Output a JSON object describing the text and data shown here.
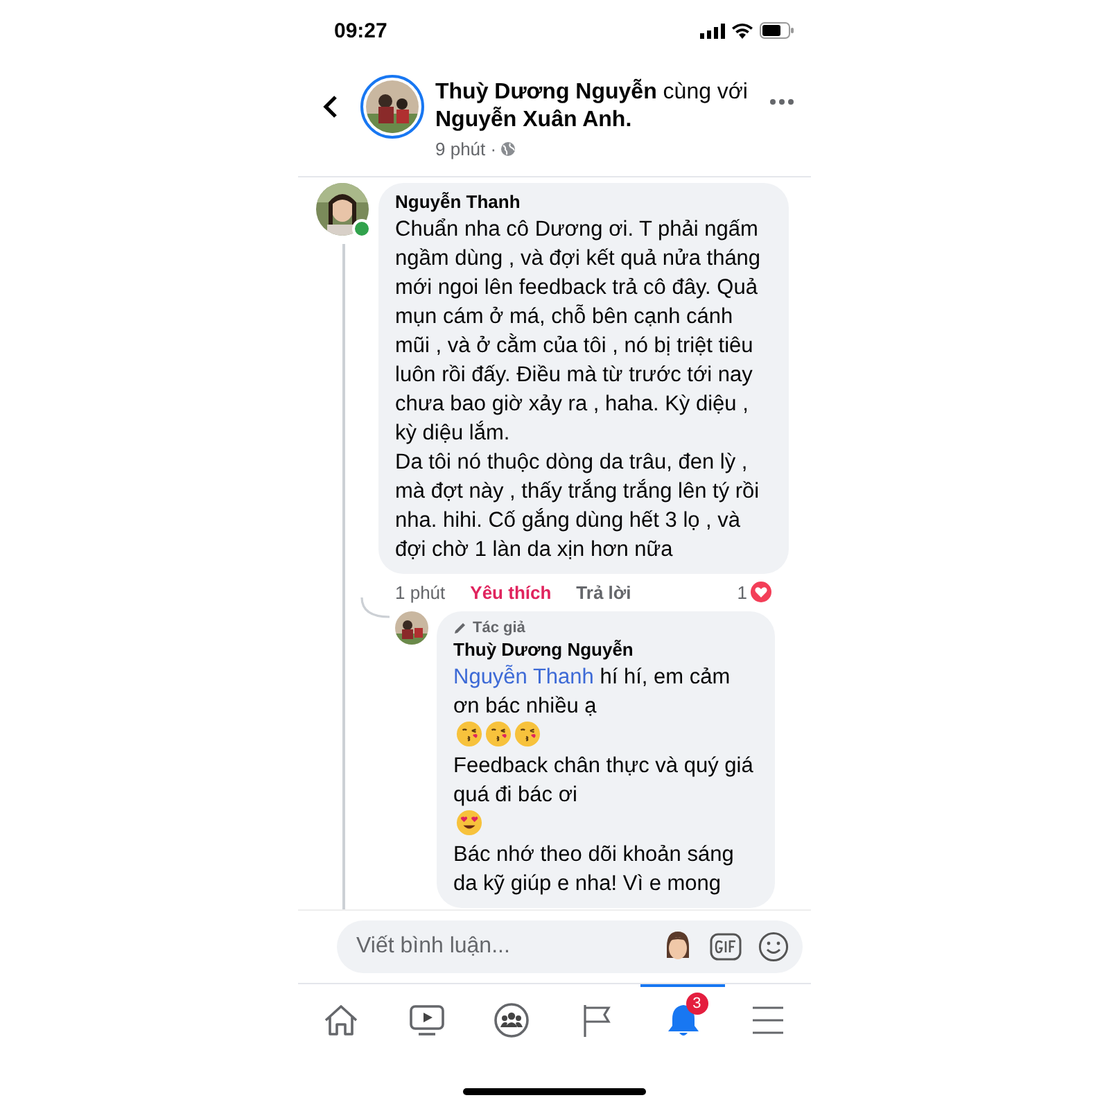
{
  "status_bar": {
    "time": "09:27"
  },
  "post_header": {
    "author": "Thuỳ Dương Nguyễn",
    "joiner": "cùng với",
    "tagged": "Nguyễn Xuân Anh.",
    "time": "9 phút ·"
  },
  "comment": {
    "author": "Nguyễn Thanh",
    "online": true,
    "paragraphs": [
      "Chuẩn nha cô Dương ơi. T phải ngấm ngầm dùng , và đợi kết quả nửa tháng mới ngoi lên feedback trả cô đây. Quả mụn cám ở má, chỗ bên cạnh cánh mũi , và ở cằm của tôi , nó bị triệt tiêu luôn rồi đấy. Điều mà từ trước tới nay chưa bao giờ xảy ra , haha. Kỳ diệu , kỳ diệu lắm.",
      "Da tôi nó thuộc dòng da trâu, đen lỳ , mà đợt này , thấy trắng trắng lên tý rồi nha. hihi. Cố gắng dùng hết 3 lọ  , và đợi chờ 1 làn da xịn hơn nữa"
    ],
    "time": "1 phút",
    "like": "Yêu thích",
    "liked": true,
    "reply": "Trả lời",
    "reaction_count": "1"
  },
  "reply": {
    "badge": "Tác giả",
    "author": "Thuỳ Dương Nguyễn",
    "paragraphs": [
      {
        "mention": "Nguyễn Thanh",
        "text": "hí hí, em cảm ơn bác nhiều ạ",
        "emojis": [
          {
            "kind": "kiss"
          },
          {
            "kind": "kiss"
          },
          {
            "kind": "kiss"
          }
        ]
      },
      {
        "text": "Feedback chân thực và quý giá quá đi bác ơi",
        "emojis": [
          {
            "kind": "heart-eyes"
          }
        ]
      },
      {
        "text": "Bác nhớ theo dõi khoản sáng da kỹ giúp e nha! Vì e mong"
      }
    ]
  },
  "composer": {
    "placeholder": "Viết bình luận..."
  },
  "tabs": [
    {
      "kind": "home",
      "selected": false
    },
    {
      "kind": "video",
      "selected": false
    },
    {
      "kind": "groups",
      "selected": false
    },
    {
      "kind": "flag",
      "selected": false
    },
    {
      "kind": "bell",
      "selected": true,
      "badge": "3"
    },
    {
      "kind": "menu",
      "selected": false
    }
  ]
}
